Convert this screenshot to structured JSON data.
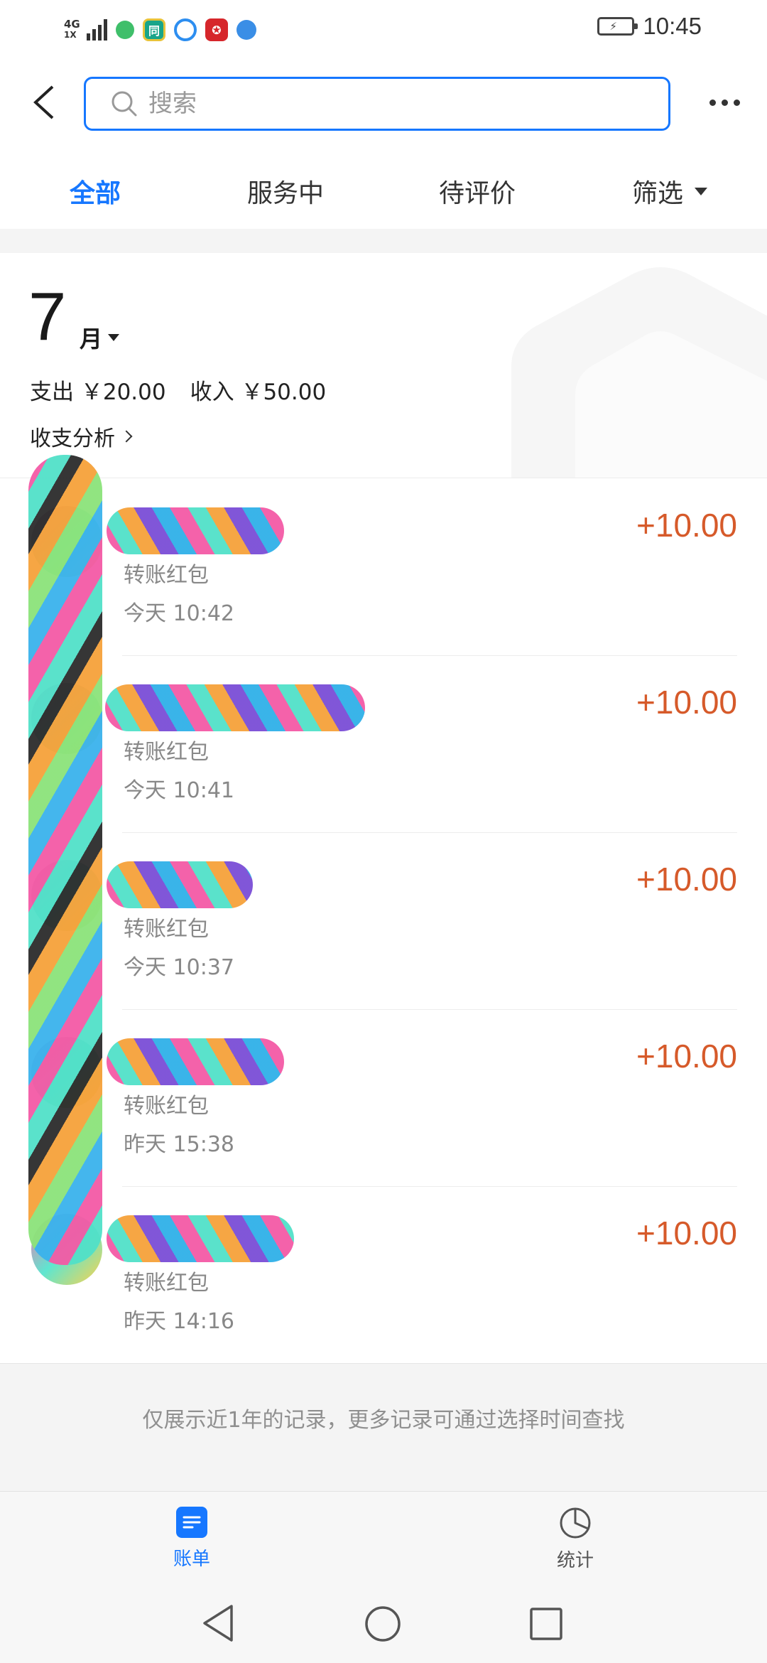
{
  "status_bar": {
    "network": "4G",
    "network_sub": "1X",
    "time": "10:45"
  },
  "search": {
    "placeholder": "搜索"
  },
  "tabs": [
    {
      "label": "全部",
      "active": true
    },
    {
      "label": "服务中",
      "active": false
    },
    {
      "label": "待评价",
      "active": false
    },
    {
      "label": "筛选",
      "active": false
    }
  ],
  "summary": {
    "month_number": "7",
    "month_unit": "月",
    "expense": "支出 ￥20.00",
    "income": "收入 ￥50.00",
    "analysis_link": "收支分析"
  },
  "transactions": [
    {
      "type": "转账红包",
      "time": "今天  10:42",
      "amount": "+10.00"
    },
    {
      "type": "转账红包",
      "time": "今天  10:41",
      "amount": "+10.00"
    },
    {
      "type": "转账红包",
      "time": "今天  10:37",
      "amount": "+10.00"
    },
    {
      "type": "转账红包",
      "time": "昨天  15:38",
      "amount": "+10.00"
    },
    {
      "type": "转账红包",
      "time": "昨天  14:16",
      "amount": "+10.00"
    }
  ],
  "footer_note": "仅展示近1年的记录，更多记录可通过选择时间查找",
  "bottom_nav": {
    "bill_label": "账单",
    "stats_label": "统计"
  },
  "colors": {
    "accent": "#1677ff",
    "amount": "#d65a2a"
  }
}
